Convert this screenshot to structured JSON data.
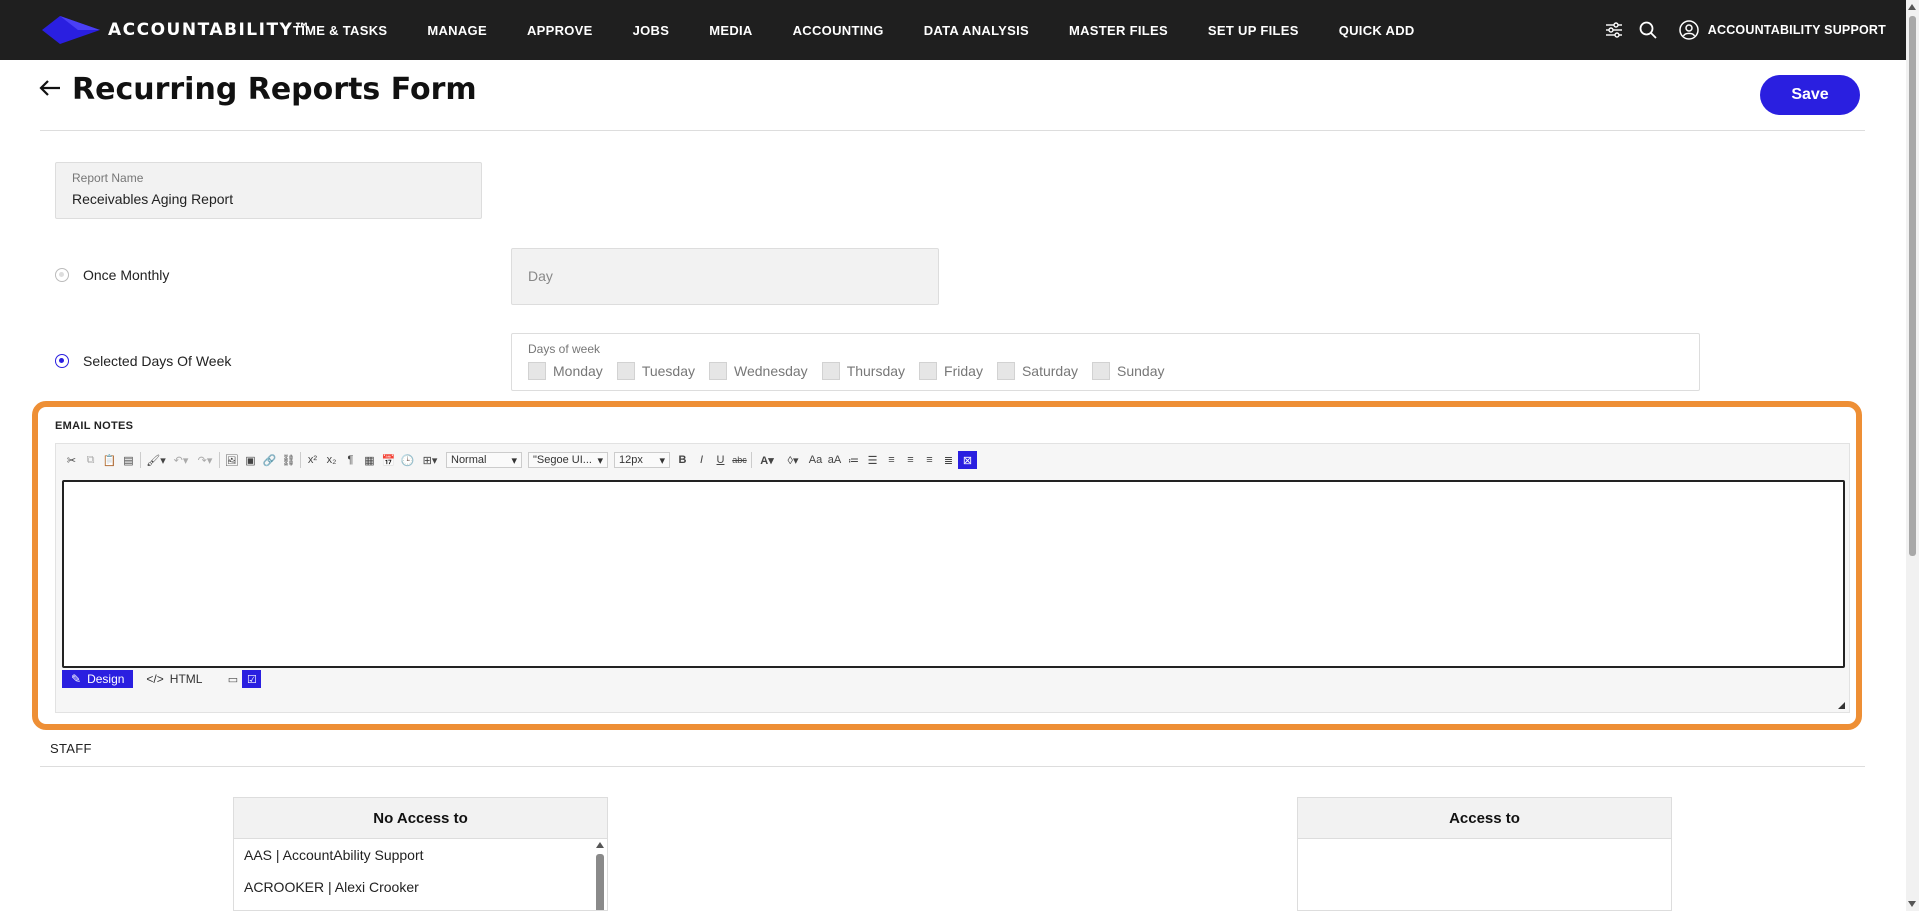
{
  "app": {
    "brand": "ACCOUNTABILITY™",
    "nav": [
      "TIME & TASKS",
      "MANAGE",
      "APPROVE",
      "JOBS",
      "MEDIA",
      "ACCOUNTING",
      "DATA ANALYSIS",
      "MASTER FILES",
      "SET UP FILES",
      "QUICK ADD"
    ],
    "user_label": "ACCOUNTABILITY SUPPORT",
    "icons": [
      "filter-sliders-icon",
      "search-icon",
      "user-circle-icon"
    ]
  },
  "page": {
    "title": "Recurring Reports Form",
    "save_label": "Save"
  },
  "form": {
    "report_name_label": "Report Name",
    "report_name_value": "Receivables Aging Report",
    "once_monthly_label": "Once Monthly",
    "day_placeholder": "Day",
    "selected_days_label": "Selected Days Of Week",
    "days_of_week_label": "Days of week",
    "days": [
      "Monday",
      "Tuesday",
      "Wednesday",
      "Thursday",
      "Friday",
      "Saturday",
      "Sunday"
    ]
  },
  "email_notes": {
    "title": "EMAIL NOTES",
    "paragraph_style": "Normal",
    "font_name": "\"Segoe UI...",
    "font_size": "12px",
    "mode_design": "Design",
    "mode_html": "HTML"
  },
  "staff": {
    "title": "STAFF",
    "no_access_header": "No Access to",
    "access_header": "Access to",
    "no_access_items": [
      "AAS | AccountAbility Support",
      "ACROOKER | Alexi Crooker"
    ]
  },
  "colors": {
    "accent": "#2a1fe0",
    "highlight": "#ee8f35",
    "topbar": "#1f1f1f"
  }
}
